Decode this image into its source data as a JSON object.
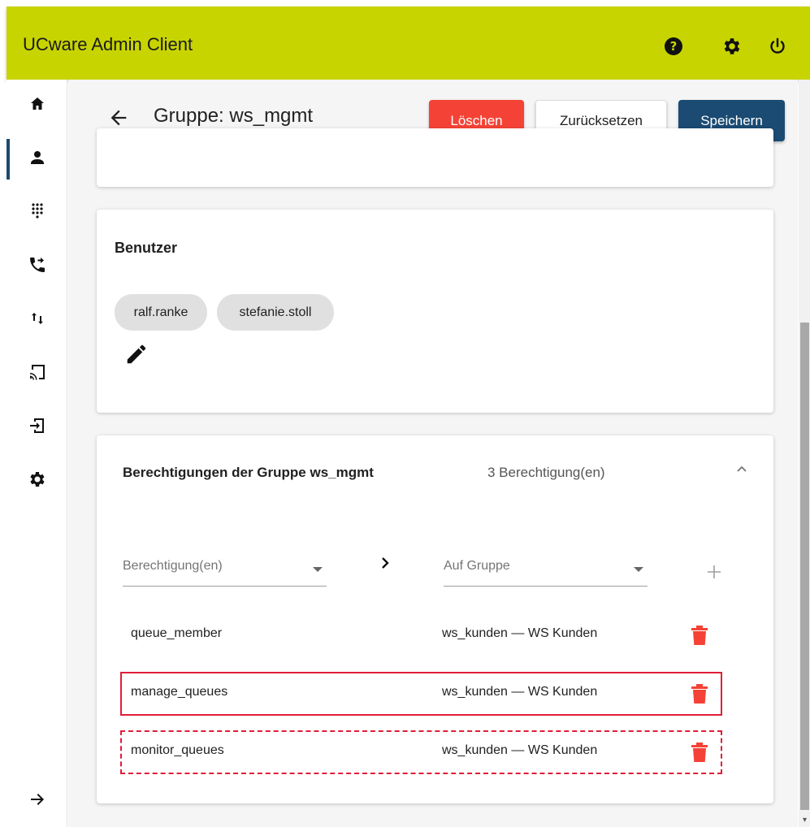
{
  "app": {
    "title": "UCware Admin Client"
  },
  "topbar_icons": [
    "help-icon",
    "settings-icon",
    "power-icon"
  ],
  "sidebar": {
    "items": [
      {
        "icon": "home-icon",
        "active": false
      },
      {
        "icon": "person-icon",
        "active": true
      },
      {
        "icon": "dialpad-icon",
        "active": false
      },
      {
        "icon": "phone-forward-icon",
        "active": false
      },
      {
        "icon": "swap-vert-icon",
        "active": false
      },
      {
        "icon": "cast-icon",
        "active": false
      },
      {
        "icon": "login-icon",
        "active": false
      },
      {
        "icon": "settings-icon",
        "active": false
      }
    ],
    "expand_icon": "arrow-right-icon"
  },
  "header": {
    "title": "Gruppe: ws_mgmt",
    "delete_label": "Löschen",
    "reset_label": "Zurücksetzen",
    "save_label": "Speichern"
  },
  "users_card": {
    "heading": "Benutzer",
    "chips": [
      "ralf.ranke",
      "stefanie.stoll"
    ]
  },
  "permissions_card": {
    "title": "Berechtigungen der Gruppe ws_mgmt",
    "count": "3 Berechtigung(en)",
    "permission_select_placeholder": "Berechtigung(en)",
    "group_select_placeholder": "Auf Gruppe",
    "rows": [
      {
        "name": "queue_member",
        "group": "ws_kunden — WS Kunden"
      },
      {
        "name": "manage_queues",
        "group": "ws_kunden — WS Kunden"
      },
      {
        "name": "monitor_queues",
        "group": "ws_kunden — WS Kunden"
      }
    ]
  },
  "colors": {
    "topbar": "#c8d400",
    "delete": "#f44336",
    "save": "#1b4b72",
    "trash": "#f44336",
    "highlight": "#e01e37"
  }
}
